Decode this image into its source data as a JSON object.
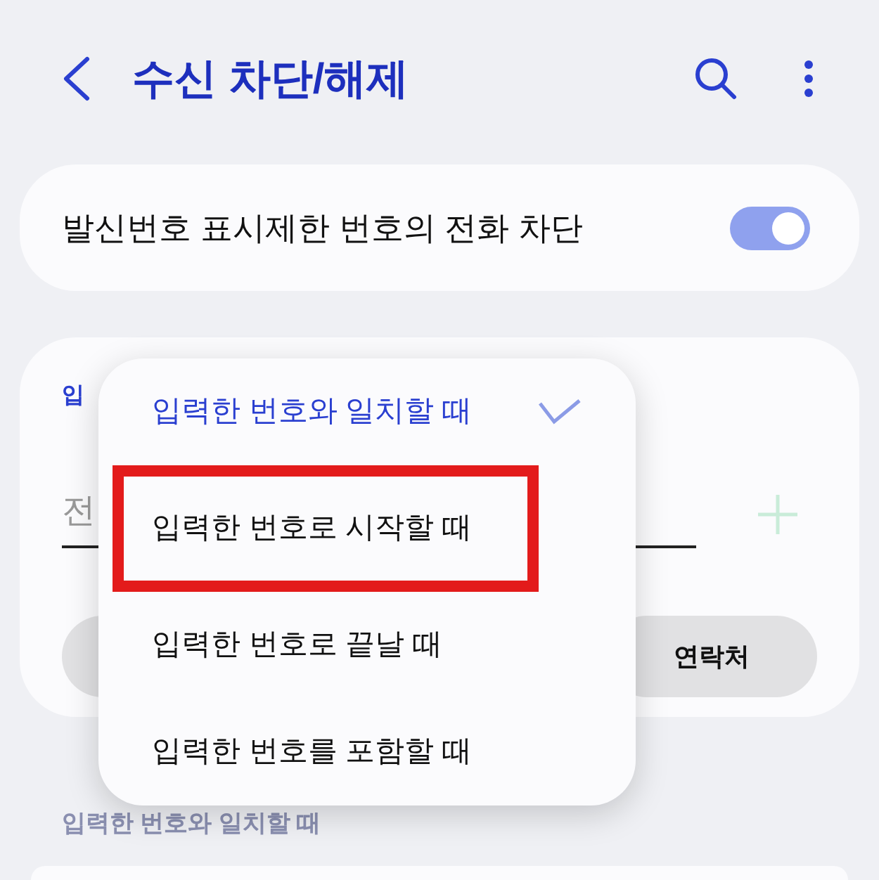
{
  "header": {
    "title": "수신 차단/해제"
  },
  "private_block": {
    "label": "발신번호 표시제한 번호의 전화 차단",
    "on": true
  },
  "number_card": {
    "label": "입",
    "field": {
      "placeholder": "전"
    },
    "contacts_button": "연락처"
  },
  "match_menu": {
    "options": [
      {
        "label": "입력한 번호와 일치할 때",
        "selected": true,
        "highlighted": false
      },
      {
        "label": "입력한 번호로 시작할 때",
        "selected": false,
        "highlighted": true
      },
      {
        "label": "입력한 번호로 끝날 때",
        "selected": false,
        "highlighted": false
      },
      {
        "label": "입력한 번호를 포함할 때",
        "selected": false,
        "highlighted": false
      }
    ]
  },
  "section_label": "입력한 번호와 일치할 때"
}
